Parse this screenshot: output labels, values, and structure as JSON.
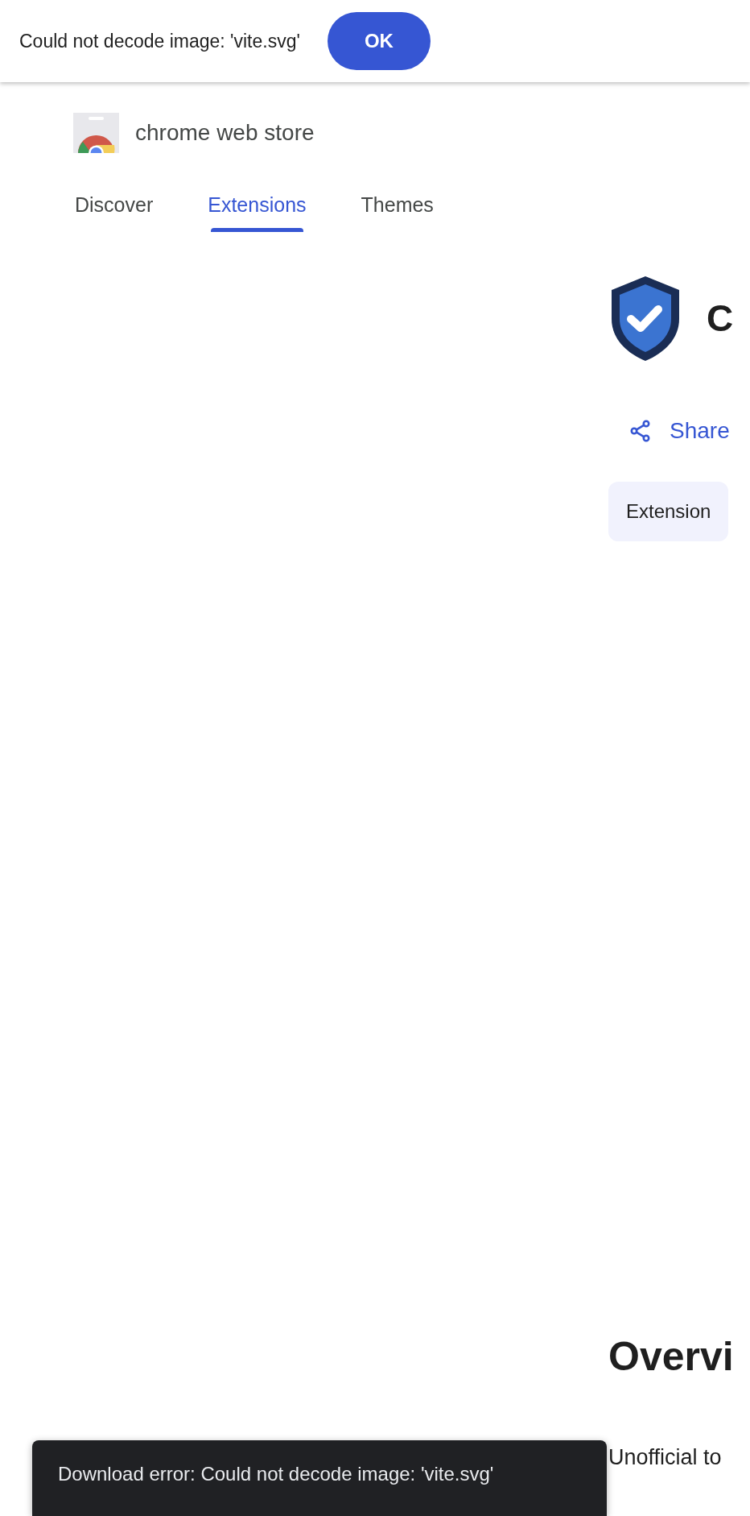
{
  "alert": {
    "message": "Could not decode image: 'vite.svg'",
    "button": "OK"
  },
  "header": {
    "brand": "chrome web store"
  },
  "tabs": [
    {
      "label": "Discover",
      "selected": false
    },
    {
      "label": "Extensions",
      "selected": true
    },
    {
      "label": "Themes",
      "selected": false
    }
  ],
  "item": {
    "title": "C",
    "share": "Share",
    "tag": "Extension"
  },
  "overview": {
    "heading": "Overvi",
    "text": "Unofficial to"
  },
  "snackbar": {
    "message": "Download error: Could not decode image: 'vite.svg'"
  }
}
